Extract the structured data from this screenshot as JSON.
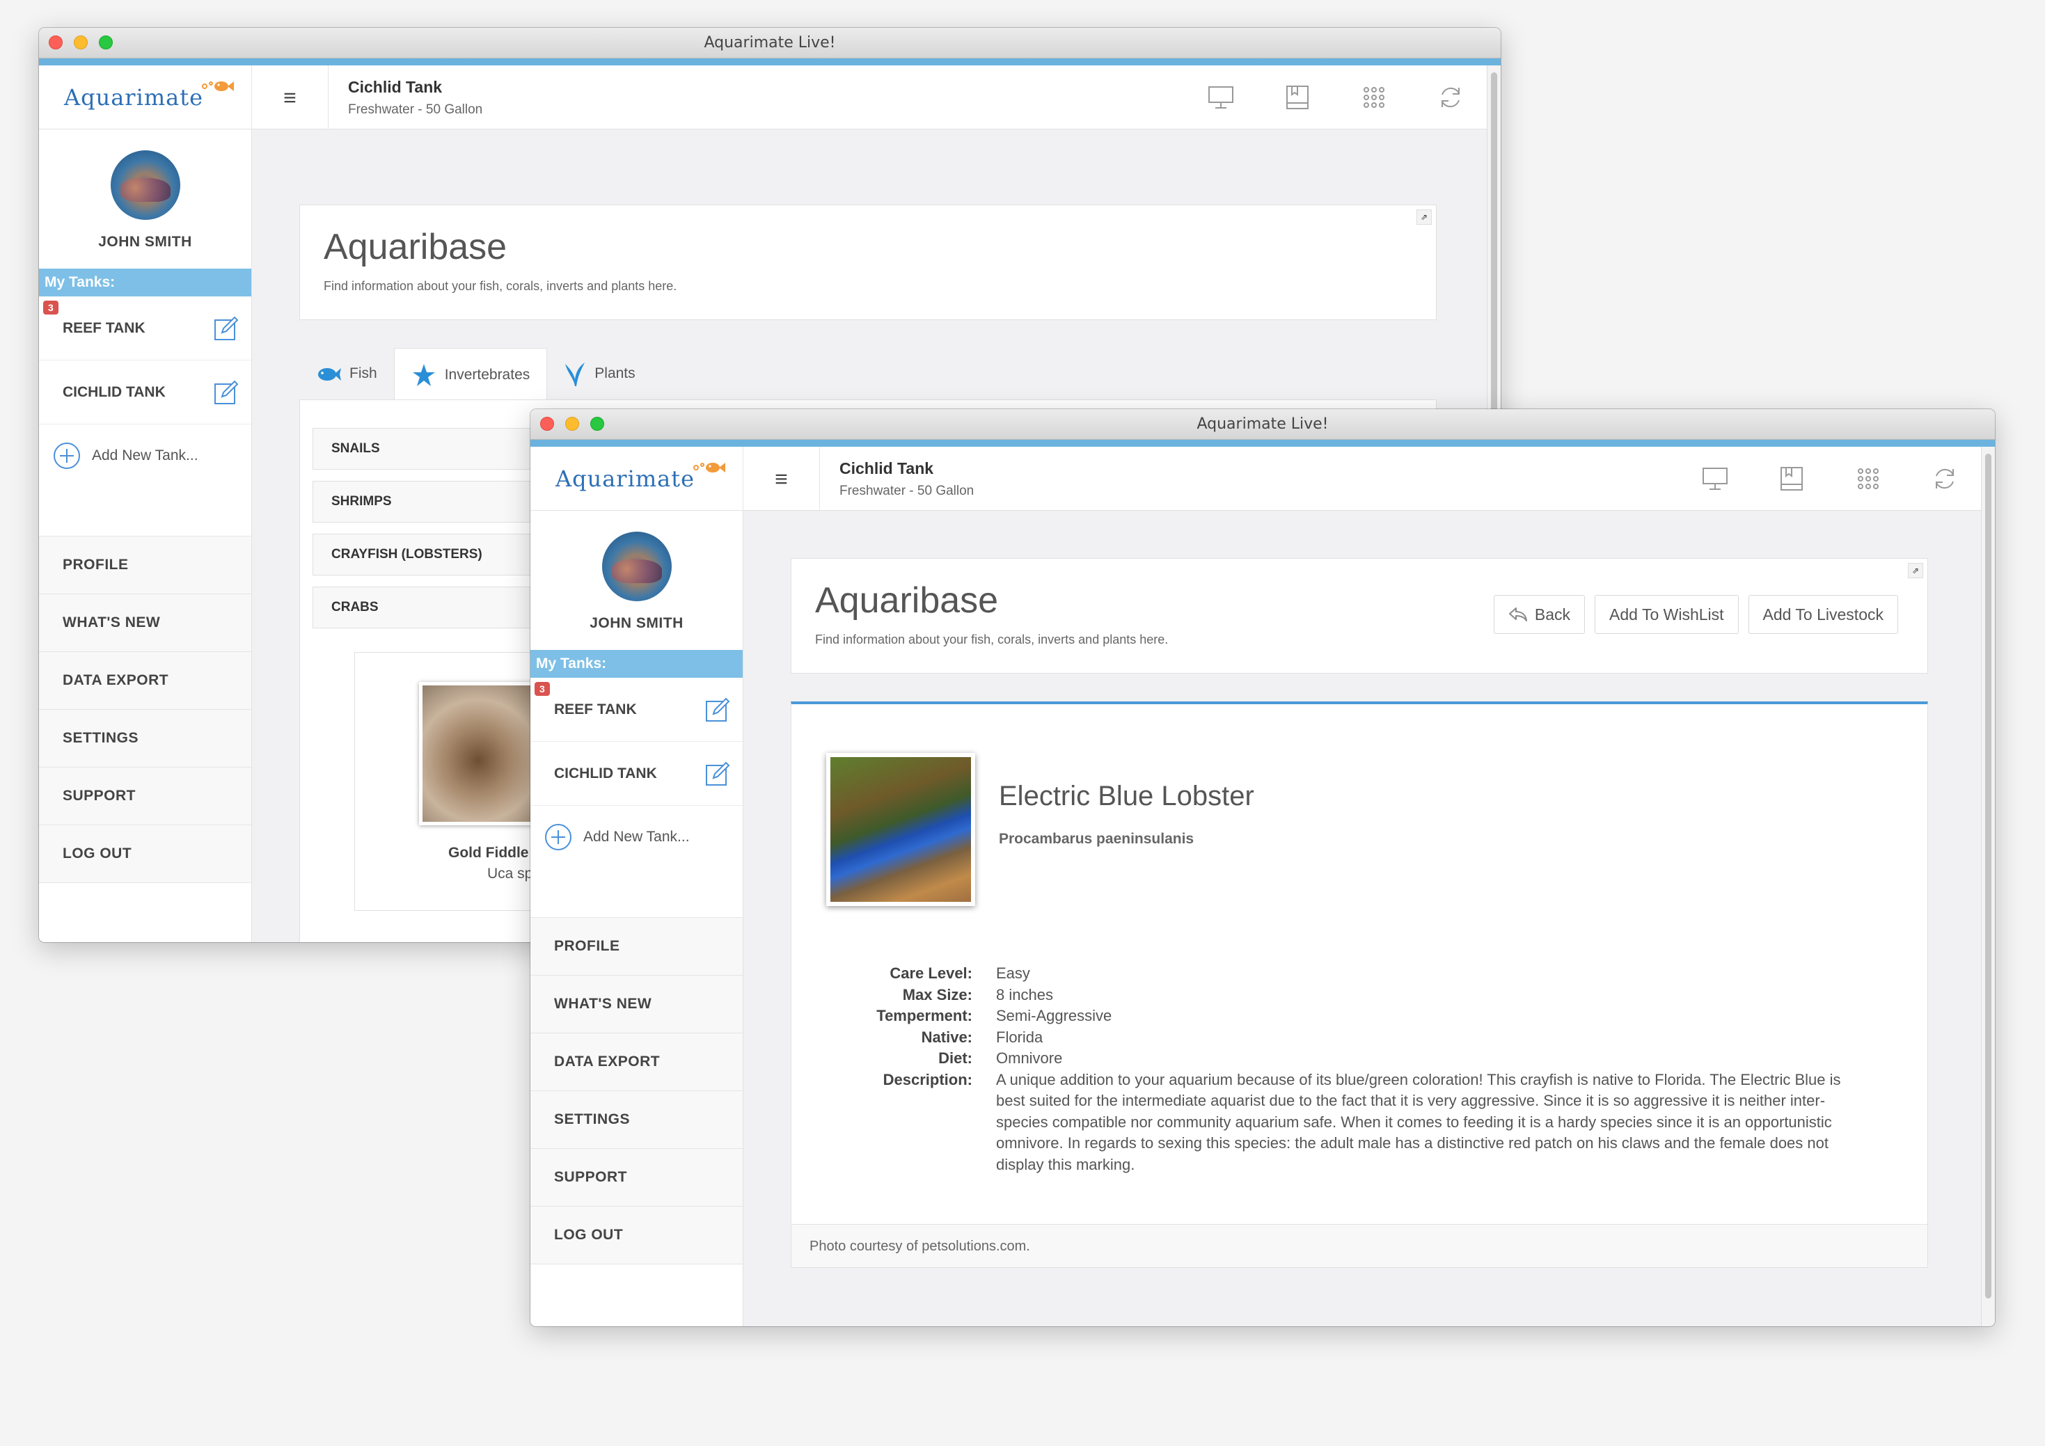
{
  "app": {
    "window_title": "Aquarimate Live!",
    "logo_text": "Aquarimate",
    "tank_name": "Cichlid Tank",
    "tank_subtitle": "Freshwater - 50 Gallon"
  },
  "sidebar": {
    "user_name": "JOHN SMITH",
    "my_tanks_label": "My Tanks:",
    "tanks": [
      {
        "name": "REEF TANK",
        "badge": "3"
      },
      {
        "name": "CICHLID TANK",
        "badge": ""
      }
    ],
    "add_tank_label": "Add New Tank...",
    "nav": [
      "PROFILE",
      "WHAT'S NEW",
      "DATA EXPORT",
      "SETTINGS",
      "SUPPORT",
      "LOG OUT"
    ]
  },
  "page": {
    "title": "Aquaribase",
    "subtitle": "Find information about your fish, corals, inverts and plants here.",
    "pin_label": "⇗"
  },
  "back_window": {
    "tabs": [
      {
        "label": "Fish",
        "icon": "fish-icon"
      },
      {
        "label": "Invertebrates",
        "icon": "starfish-icon"
      },
      {
        "label": "Plants",
        "icon": "plant-icon"
      }
    ],
    "active_tab": "Invertebrates",
    "categories": [
      "SNAILS",
      "SHRIMPS",
      "CRAYFISH (LOBSTERS)",
      "CRABS"
    ],
    "species_card": {
      "name": "Gold Fiddle",
      "latin": "Uca sp"
    }
  },
  "front_window": {
    "buttons": {
      "back": "Back",
      "wishlist": "Add To WishList",
      "livestock": "Add To Livestock"
    },
    "species": {
      "common_name": "Electric Blue Lobster",
      "latin_name": "Procambarus paeninsulanis"
    },
    "details": [
      {
        "label": "Care Level:",
        "value": "Easy"
      },
      {
        "label": "Max Size:",
        "value": "8 inches"
      },
      {
        "label": "Temperment:",
        "value": "Semi-Aggressive"
      },
      {
        "label": "Native:",
        "value": "Florida"
      },
      {
        "label": "Diet:",
        "value": "Omnivore"
      },
      {
        "label": "Description:",
        "value": "A unique addition to your aquarium because of its blue/green coloration! This crayfish is native to Florida. The Electric Blue is best suited for the intermediate aquarist due to the fact that it is very aggressive. Since it is so aggressive it is neither inter-species compatible nor community aquarium safe. When it comes to feeding it is a hardy species since it is an opportunistic omnivore. In regards to sexing this species: the adult male has a distinctive red patch on his claws and the female does not display this marking."
      }
    ],
    "photo_credit": "Photo courtesy of petsolutions.com."
  },
  "colors": {
    "accent": "#6bb3de",
    "brand": "#2d6fb5",
    "badge": "#d9534f",
    "tank_header": "#7dbfe6"
  }
}
